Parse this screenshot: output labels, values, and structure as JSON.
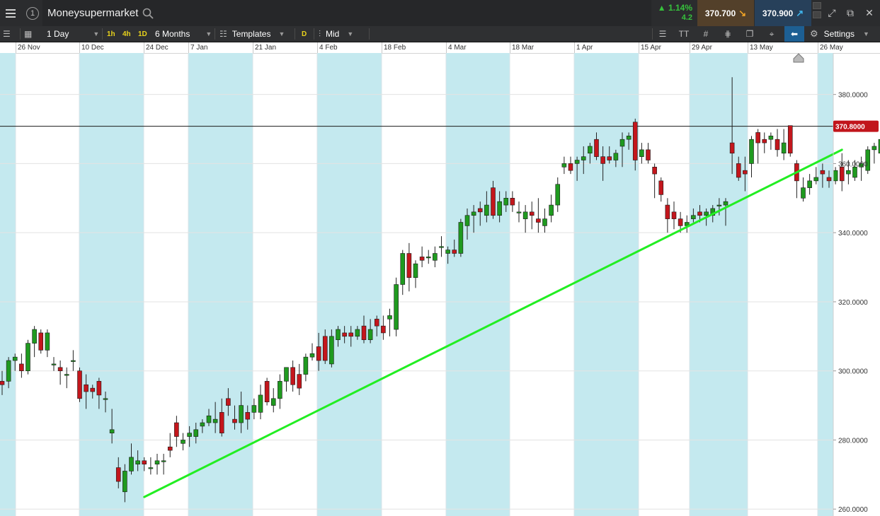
{
  "header": {
    "title": "Moneysupermarket",
    "change_pct": "▲ 1.14%",
    "change_val": "4.2",
    "sell_price": "370.700",
    "buy_price": "370.900"
  },
  "toolbar": {
    "interval": "1 Day",
    "quick_1h": "1h",
    "quick_4h": "4h",
    "quick_1d": "1D",
    "range": "6 Months",
    "templates": "Templates",
    "price_mode_badge": "D",
    "price_mode": "Mid",
    "text_tool": "TT",
    "settings": "Settings"
  },
  "colors": {
    "bull": "#1f9a1f",
    "bear": "#c4161c",
    "trendline": "#22ee22",
    "band": "#c4e9ef",
    "price_tag": "#c1151b"
  },
  "chart_data": {
    "type": "candlestick",
    "title": "",
    "current_price": 370.8,
    "current_price_label": "370.8000",
    "x_labels": [
      "26 Nov",
      "10 Dec",
      "24 Dec",
      "7 Jan",
      "21 Jan",
      "4 Feb",
      "18 Feb",
      "4 Mar",
      "18 Mar",
      "1 Apr",
      "15 Apr",
      "29 Apr",
      "13 May",
      "26 May"
    ],
    "y_ticks": [
      {
        "value": 380,
        "label": "380.0000"
      },
      {
        "value": 360,
        "label": "360.0000"
      },
      {
        "value": 340,
        "label": "340.0000"
      },
      {
        "value": 320,
        "label": "320.0000"
      },
      {
        "value": 300,
        "label": "300.0000"
      },
      {
        "value": 280,
        "label": "280.0000"
      },
      {
        "value": 260,
        "label": "260.0000"
      }
    ],
    "ylim": [
      258,
      392
    ],
    "trendline": {
      "from_index": 22,
      "from_value": 263.5,
      "to_index": 130,
      "to_value": 364
    },
    "candles": [
      [
        297,
        300,
        293,
        296
      ],
      [
        297,
        304,
        295,
        303
      ],
      [
        303,
        305,
        300,
        304
      ],
      [
        302,
        305,
        298,
        300
      ],
      [
        300,
        309,
        299,
        308
      ],
      [
        308,
        313,
        304,
        312
      ],
      [
        311,
        312,
        305,
        306
      ],
      [
        306,
        312,
        304,
        311
      ],
      [
        302,
        304,
        300,
        302
      ],
      [
        301,
        303,
        296,
        300
      ],
      [
        299,
        301,
        295,
        299
      ],
      [
        303,
        306,
        300,
        303
      ],
      [
        300,
        301,
        291,
        292
      ],
      [
        296,
        299,
        289,
        294
      ],
      [
        295,
        296,
        292,
        294
      ],
      [
        297,
        298,
        289,
        293
      ],
      [
        292,
        294,
        288,
        292
      ],
      [
        282,
        289,
        279,
        283
      ],
      [
        272,
        275,
        266,
        268
      ],
      [
        265,
        273,
        262,
        271
      ],
      [
        271,
        279,
        270,
        275
      ],
      [
        273,
        277,
        271,
        274
      ],
      [
        274,
        275,
        271,
        273
      ],
      [
        272,
        275,
        270,
        272
      ],
      [
        273,
        276,
        270,
        274
      ],
      [
        274,
        276,
        270,
        274
      ],
      [
        278,
        282,
        275,
        277
      ],
      [
        285,
        287,
        278,
        281
      ],
      [
        279,
        282,
        277,
        280
      ],
      [
        281,
        284,
        278,
        282
      ],
      [
        281,
        285,
        279,
        283
      ],
      [
        284,
        286,
        282,
        285
      ],
      [
        285,
        289,
        284,
        287
      ],
      [
        285,
        291,
        282,
        286
      ],
      [
        288,
        292,
        281,
        282
      ],
      [
        292,
        295,
        287,
        290
      ],
      [
        286,
        290,
        283,
        285
      ],
      [
        285,
        294,
        282,
        290
      ],
      [
        288,
        290,
        283,
        286
      ],
      [
        288,
        292,
        286,
        290
      ],
      [
        288,
        296,
        286,
        293
      ],
      [
        297,
        298,
        290,
        291
      ],
      [
        290,
        295,
        288,
        292
      ],
      [
        292,
        299,
        289,
        297
      ],
      [
        297,
        301,
        294,
        301
      ],
      [
        301,
        303,
        294,
        296
      ],
      [
        299,
        302,
        293,
        295
      ],
      [
        299,
        305,
        297,
        304
      ],
      [
        304,
        308,
        303,
        305
      ],
      [
        307,
        311,
        300,
        303
      ],
      [
        310,
        312,
        302,
        303
      ],
      [
        302,
        312,
        301,
        310
      ],
      [
        309,
        313,
        307,
        312
      ],
      [
        311,
        313,
        308,
        310
      ],
      [
        311,
        313,
        307,
        310
      ],
      [
        310,
        313,
        309,
        312
      ],
      [
        313,
        316,
        308,
        309
      ],
      [
        309,
        315,
        308,
        312
      ],
      [
        315,
        316,
        310,
        313
      ],
      [
        313,
        316,
        309,
        311
      ],
      [
        315,
        318,
        310,
        316
      ],
      [
        312,
        327,
        310,
        325
      ],
      [
        325,
        335,
        322,
        334
      ],
      [
        334,
        337,
        323,
        327
      ],
      [
        327,
        332,
        324,
        331
      ],
      [
        333,
        336,
        330,
        332
      ],
      [
        333,
        335,
        331,
        333
      ],
      [
        332,
        336,
        330,
        334
      ],
      [
        336,
        339,
        333,
        336
      ],
      [
        334,
        336,
        331,
        335
      ],
      [
        335,
        338,
        333,
        334
      ],
      [
        334,
        344,
        333,
        343
      ],
      [
        342,
        347,
        338,
        345
      ],
      [
        345,
        348,
        340,
        346
      ],
      [
        347,
        349,
        342,
        346
      ],
      [
        345,
        352,
        343,
        348
      ],
      [
        353,
        355,
        344,
        345
      ],
      [
        345,
        352,
        343,
        349
      ],
      [
        348,
        352,
        346,
        350
      ],
      [
        350,
        352,
        346,
        348
      ],
      [
        346,
        349,
        343,
        346
      ],
      [
        344,
        348,
        340,
        346
      ],
      [
        346,
        349,
        341,
        345
      ],
      [
        344,
        350,
        340,
        343
      ],
      [
        342,
        347,
        340,
        344
      ],
      [
        345,
        351,
        343,
        348
      ],
      [
        348,
        356,
        346,
        354
      ],
      [
        359,
        362,
        357,
        360
      ],
      [
        360,
        362,
        357,
        358
      ],
      [
        360,
        362,
        355,
        361
      ],
      [
        361,
        365,
        357,
        362
      ],
      [
        363,
        366,
        360,
        365
      ],
      [
        367,
        369,
        361,
        362
      ],
      [
        362,
        365,
        355,
        360
      ],
      [
        362,
        365,
        360,
        361
      ],
      [
        361,
        364,
        359,
        363
      ],
      [
        365,
        369,
        359,
        367
      ],
      [
        367,
        369,
        364,
        368
      ],
      [
        372,
        373,
        358,
        361
      ],
      [
        362,
        366,
        360,
        364
      ],
      [
        364,
        366,
        360,
        361
      ],
      [
        359,
        360,
        350,
        357
      ],
      [
        355,
        356,
        349,
        351
      ],
      [
        348,
        350,
        340,
        344
      ],
      [
        346,
        349,
        341,
        344
      ],
      [
        344,
        346,
        340,
        342
      ],
      [
        342,
        345,
        340,
        343
      ],
      [
        344,
        347,
        343,
        345
      ],
      [
        346,
        348,
        343,
        345
      ],
      [
        345,
        347,
        342,
        346
      ],
      [
        345,
        348,
        343,
        347
      ],
      [
        348,
        350,
        345,
        348
      ],
      [
        348,
        350,
        342,
        349
      ],
      [
        366,
        385,
        357,
        363
      ],
      [
        360,
        362,
        355,
        356
      ],
      [
        358,
        362,
        352,
        357
      ],
      [
        360,
        368,
        356,
        367
      ],
      [
        369,
        370,
        360,
        366
      ],
      [
        367,
        369,
        363,
        366
      ],
      [
        367,
        369,
        364,
        368
      ],
      [
        367,
        370,
        362,
        364
      ],
      [
        363,
        370,
        361,
        366
      ],
      [
        371,
        371,
        362,
        363
      ],
      [
        360,
        361,
        350,
        355
      ],
      [
        350,
        356,
        349,
        353
      ],
      [
        353,
        357,
        351,
        355
      ],
      [
        355,
        359,
        354,
        356
      ],
      [
        358,
        360,
        353,
        357
      ],
      [
        356,
        358,
        353,
        355
      ],
      [
        355,
        359,
        354,
        358
      ],
      [
        359,
        363,
        352,
        355
      ],
      [
        357,
        361,
        354,
        358
      ],
      [
        356,
        361,
        355,
        359
      ],
      [
        359,
        362,
        355,
        360
      ],
      [
        358,
        365,
        357,
        364
      ],
      [
        364,
        366,
        360,
        365
      ],
      [
        363,
        368,
        362,
        367
      ],
      [
        368,
        371,
        363,
        369
      ],
      [
        370,
        376,
        367,
        368
      ],
      [
        372,
        375,
        368,
        371
      ]
    ]
  }
}
